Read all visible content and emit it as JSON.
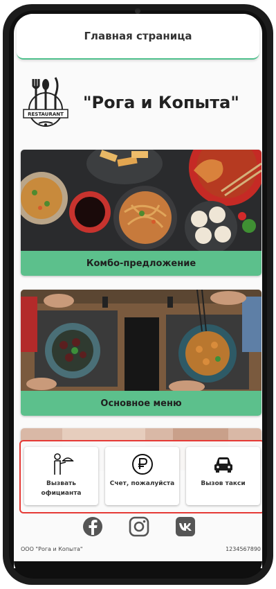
{
  "header": {
    "title": "Главная страница"
  },
  "brand": {
    "name": "\"Рога и Копыта\"",
    "logo_text": "RESTAURANT"
  },
  "cards": [
    {
      "label": "Комбо-предложение",
      "image": "asian-food-table-photo"
    },
    {
      "label": "Основное меню",
      "image": "restaurant-dinner-photo"
    },
    {
      "label": "",
      "image": "partial-card-photo"
    }
  ],
  "actions": [
    {
      "label": "Вызвать официанта",
      "icon": "waiter-icon"
    },
    {
      "label": "Счет, пожалуйста",
      "icon": "ruble-icon"
    },
    {
      "label": "Вызов такси",
      "icon": "car-icon"
    }
  ],
  "social": [
    {
      "icon": "facebook-icon"
    },
    {
      "icon": "instagram-icon"
    },
    {
      "icon": "vk-icon"
    }
  ],
  "footer": {
    "company": "ООО \"Рога и Копыта\"",
    "phone": "1234567890"
  },
  "colors": {
    "accent": "#5cc08c",
    "highlight_border": "#e53935",
    "header_line": "#4ec08c"
  }
}
